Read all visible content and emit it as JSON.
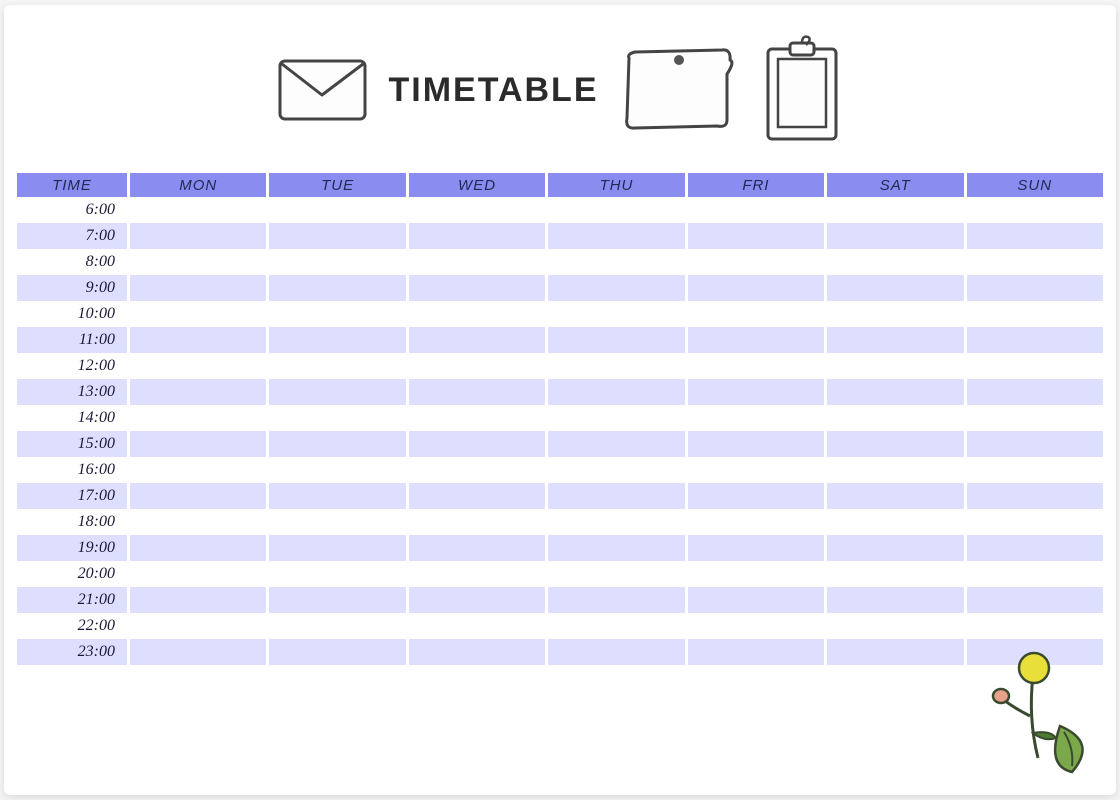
{
  "title": "TIMETABLE",
  "colors": {
    "header_bg": "#8a8cf0",
    "stripe_odd": "#dedeff",
    "stripe_even": "#ffffff",
    "text_dark": "#1a1a36"
  },
  "icons": {
    "left": "envelope-icon",
    "right_a": "pinned-note-icon",
    "right_b": "clipboard-icon",
    "corner": "flower-leaf-icon"
  },
  "columns": [
    {
      "key": "time",
      "label": "TIME"
    },
    {
      "key": "mon",
      "label": "MON"
    },
    {
      "key": "tue",
      "label": "TUE"
    },
    {
      "key": "wed",
      "label": "WED"
    },
    {
      "key": "thu",
      "label": "THU"
    },
    {
      "key": "fri",
      "label": "FRI"
    },
    {
      "key": "sat",
      "label": "SAT"
    },
    {
      "key": "sun",
      "label": "SUN"
    }
  ],
  "rows": [
    {
      "time": "6:00",
      "mon": "",
      "tue": "",
      "wed": "",
      "thu": "",
      "fri": "",
      "sat": "",
      "sun": ""
    },
    {
      "time": "7:00",
      "mon": "",
      "tue": "",
      "wed": "",
      "thu": "",
      "fri": "",
      "sat": "",
      "sun": ""
    },
    {
      "time": "8:00",
      "mon": "",
      "tue": "",
      "wed": "",
      "thu": "",
      "fri": "",
      "sat": "",
      "sun": ""
    },
    {
      "time": "9:00",
      "mon": "",
      "tue": "",
      "wed": "",
      "thu": "",
      "fri": "",
      "sat": "",
      "sun": ""
    },
    {
      "time": "10:00",
      "mon": "",
      "tue": "",
      "wed": "",
      "thu": "",
      "fri": "",
      "sat": "",
      "sun": ""
    },
    {
      "time": "11:00",
      "mon": "",
      "tue": "",
      "wed": "",
      "thu": "",
      "fri": "",
      "sat": "",
      "sun": ""
    },
    {
      "time": "12:00",
      "mon": "",
      "tue": "",
      "wed": "",
      "thu": "",
      "fri": "",
      "sat": "",
      "sun": ""
    },
    {
      "time": "13:00",
      "mon": "",
      "tue": "",
      "wed": "",
      "thu": "",
      "fri": "",
      "sat": "",
      "sun": ""
    },
    {
      "time": "14:00",
      "mon": "",
      "tue": "",
      "wed": "",
      "thu": "",
      "fri": "",
      "sat": "",
      "sun": ""
    },
    {
      "time": "15:00",
      "mon": "",
      "tue": "",
      "wed": "",
      "thu": "",
      "fri": "",
      "sat": "",
      "sun": ""
    },
    {
      "time": "16:00",
      "mon": "",
      "tue": "",
      "wed": "",
      "thu": "",
      "fri": "",
      "sat": "",
      "sun": ""
    },
    {
      "time": "17:00",
      "mon": "",
      "tue": "",
      "wed": "",
      "thu": "",
      "fri": "",
      "sat": "",
      "sun": ""
    },
    {
      "time": "18:00",
      "mon": "",
      "tue": "",
      "wed": "",
      "thu": "",
      "fri": "",
      "sat": "",
      "sun": ""
    },
    {
      "time": "19:00",
      "mon": "",
      "tue": "",
      "wed": "",
      "thu": "",
      "fri": "",
      "sat": "",
      "sun": ""
    },
    {
      "time": "20:00",
      "mon": "",
      "tue": "",
      "wed": "",
      "thu": "",
      "fri": "",
      "sat": "",
      "sun": ""
    },
    {
      "time": "21:00",
      "mon": "",
      "tue": "",
      "wed": "",
      "thu": "",
      "fri": "",
      "sat": "",
      "sun": ""
    },
    {
      "time": "22:00",
      "mon": "",
      "tue": "",
      "wed": "",
      "thu": "",
      "fri": "",
      "sat": "",
      "sun": ""
    },
    {
      "time": "23:00",
      "mon": "",
      "tue": "",
      "wed": "",
      "thu": "",
      "fri": "",
      "sat": "",
      "sun": ""
    }
  ]
}
